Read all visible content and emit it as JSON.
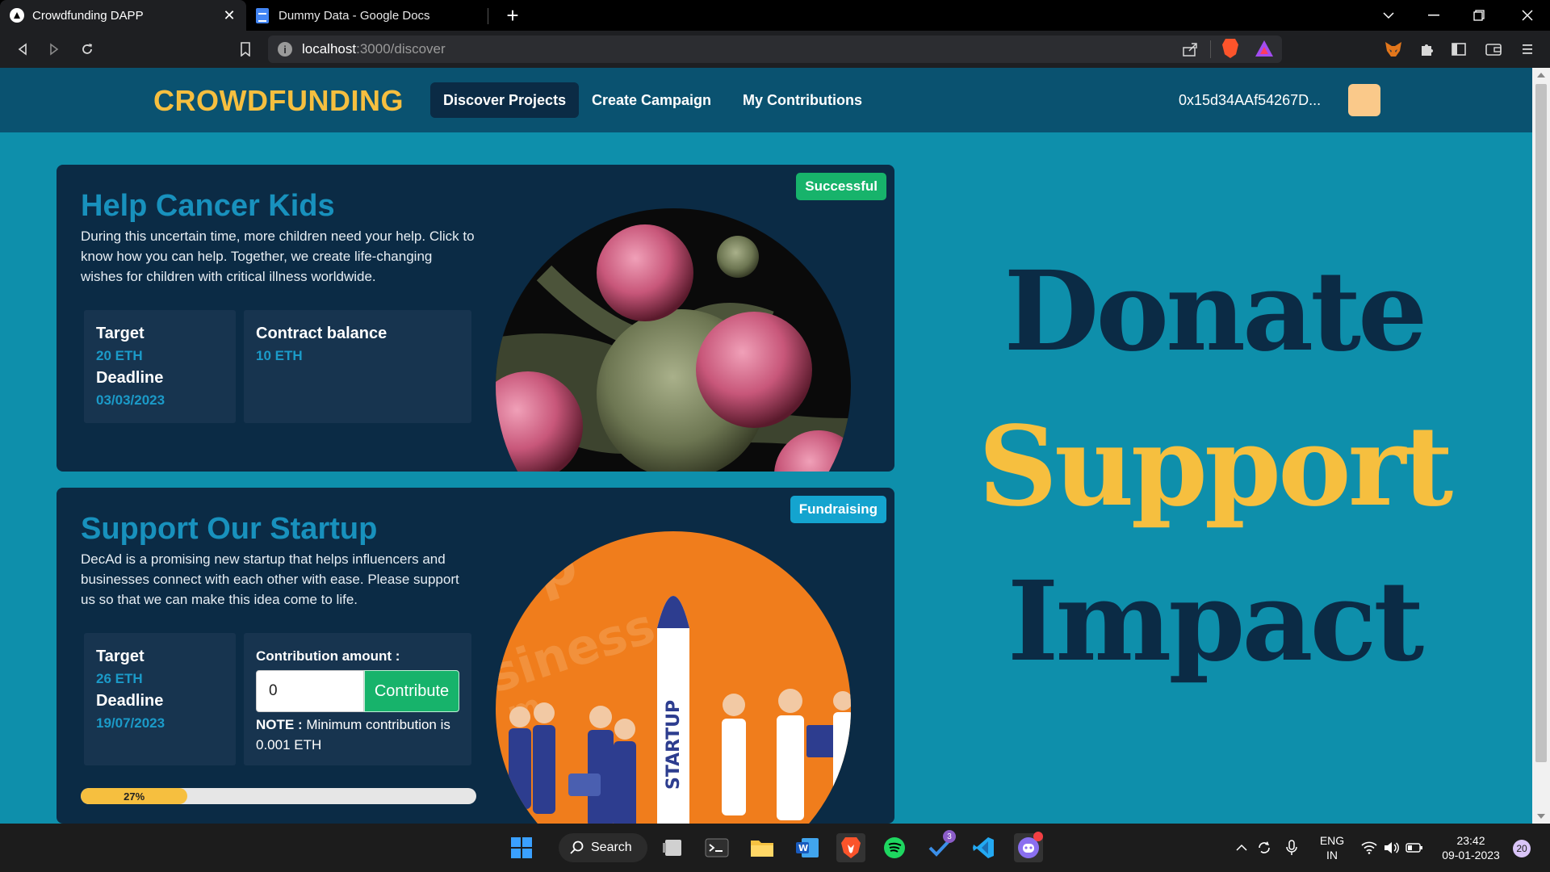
{
  "browser": {
    "tabs": [
      {
        "title": "Crowdfunding DAPP",
        "active": true
      },
      {
        "title": "Dummy Data - Google Docs",
        "active": false
      }
    ],
    "url_host": "localhost",
    "url_path": ":3000/discover"
  },
  "navbar": {
    "brand": "CROWDFUNDING",
    "links": [
      "Discover Projects",
      "Create Campaign",
      "My Contributions"
    ],
    "active_link": "Discover Projects",
    "wallet": "0x15d34AAf54267D..."
  },
  "campaigns": [
    {
      "status": "Successful",
      "title": "Help Cancer Kids",
      "description": "During this uncertain time, more children need your help. Click to know how you can help. Together, we create life-changing wishes for children with critical illness worldwide.",
      "target_label": "Target",
      "target": "20 ETH",
      "deadline_label": "Deadline",
      "deadline": "03/03/2023",
      "balance_label": "Contract balance",
      "balance": "10 ETH"
    },
    {
      "status": "Fundraising",
      "title": "Support Our Startup",
      "description": "DecAd is a promising new startup that helps influencers and businesses connect with each other with ease. Please support us so that we can make this idea come to life.",
      "target_label": "Target",
      "target": "26 ETH",
      "deadline_label": "Deadline",
      "deadline": "19/07/2023",
      "contribution_label": "Contribution amount :",
      "contribution_value": "0",
      "contribute_button": "Contribute",
      "note_label": "NOTE :",
      "note_text": " Minimum contribution is 0.001 ETH",
      "progress_label": "27%",
      "progress": 0.27,
      "image_text": "STARTUP"
    }
  ],
  "slogan": [
    "Donate",
    "Support",
    "Impact"
  ],
  "taskbar": {
    "search": "Search",
    "lang": "ENG",
    "region": "IN",
    "time": "23:42",
    "date": "09-01-2023",
    "notifications": "20",
    "todo_badge": "3"
  },
  "colors": {
    "page_bg": "#0e8fab",
    "navbar_bg": "#0a5270",
    "card_bg": "#0b2b45",
    "accent_gold": "#f6bf3f",
    "success_green": "#17b36b",
    "fundraising_blue": "#14a4cf"
  }
}
